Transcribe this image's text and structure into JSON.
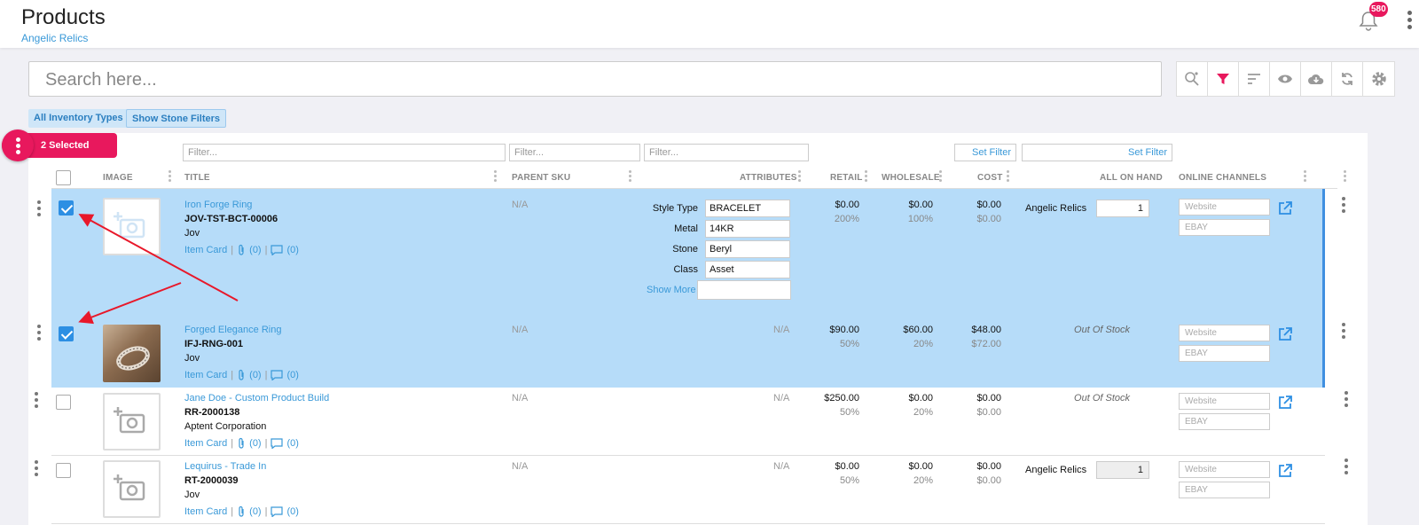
{
  "header": {
    "title": "Products",
    "subtitle": "Angelic Relics",
    "notification_count": "580"
  },
  "search": {
    "placeholder": "Search here..."
  },
  "toolbar": {
    "icons": [
      "search-settings-icon",
      "filter-icon",
      "sort-icon",
      "eye-icon",
      "cloud-download-icon",
      "refresh-icon",
      "gear-icon"
    ],
    "accent": "#e8185d"
  },
  "chips": {
    "inventory_types": "All Inventory Types",
    "stone_filters": "Show Stone Filters"
  },
  "selection": {
    "label": "2 Selected"
  },
  "filters": {
    "title_placeholder": "Filter...",
    "sku_placeholder": "Filter...",
    "attr_placeholder": "Filter...",
    "set_filter_1": "Set Filter",
    "set_filter_2": "Set Filter"
  },
  "columns": {
    "image": "IMAGE",
    "title": "TITLE",
    "parent_sku": "PARENT SKU",
    "attributes": "ATTRIBUTES",
    "retail": "RETAIL",
    "wholesale": "WHOLESALE",
    "cost": "COST",
    "on_hand": "ALL ON HAND",
    "channels": "ONLINE CHANNELS"
  },
  "rows": [
    {
      "selected": true,
      "name": "Iron Forge Ring",
      "sku": "JOV-TST-BCT-00006",
      "brand": "Jov",
      "item_card": "Item Card",
      "attach_count": "(0)",
      "comment_count": "(0)",
      "parent_sku": "N/A",
      "attributes": [
        {
          "label": "Style Type",
          "value": "BRACELET"
        },
        {
          "label": "Metal",
          "value": "14KR"
        },
        {
          "label": "Stone",
          "value": "Beryl"
        },
        {
          "label": "Class",
          "value": "Asset"
        }
      ],
      "show_more": "Show More",
      "retail": "$0.00",
      "retail_pct": "200%",
      "wholesale": "$0.00",
      "wholesale_pct": "100%",
      "cost": "$0.00",
      "cost_sub": "$0.00",
      "location": "Angelic Relics",
      "qty": "1",
      "channels": [
        "Website",
        "EBAY"
      ]
    },
    {
      "selected": true,
      "name": "Forged Elegance Ring",
      "sku": "IFJ-RNG-001",
      "brand": "Jov",
      "item_card": "Item Card",
      "attach_count": "(0)",
      "comment_count": "(0)",
      "parent_sku": "N/A",
      "attributes_na": "N/A",
      "retail": "$90.00",
      "retail_pct": "50%",
      "wholesale": "$60.00",
      "wholesale_pct": "20%",
      "cost": "$48.00",
      "cost_sub": "$72.00",
      "stock": "Out Of Stock",
      "channels": [
        "Website",
        "EBAY"
      ]
    },
    {
      "selected": false,
      "name": "Jane Doe - Custom Product Build",
      "sku": "RR-2000138",
      "brand": "Aptent Corporation",
      "item_card": "Item Card",
      "attach_count": "(0)",
      "comment_count": "(0)",
      "parent_sku": "N/A",
      "attributes_na": "N/A",
      "retail": "$250.00",
      "retail_pct": "50%",
      "wholesale": "$0.00",
      "wholesale_pct": "20%",
      "cost": "$0.00",
      "cost_sub": "$0.00",
      "stock": "Out Of Stock",
      "channels": [
        "Website",
        "EBAY"
      ]
    },
    {
      "selected": false,
      "name": "Lequirus - Trade In",
      "sku": "RT-2000039",
      "brand": "Jov",
      "item_card": "Item Card",
      "attach_count": "(0)",
      "comment_count": "(0)",
      "parent_sku": "N/A",
      "attributes_na": "N/A",
      "retail": "$0.00",
      "retail_pct": "50%",
      "wholesale": "$0.00",
      "wholesale_pct": "20%",
      "cost": "$0.00",
      "cost_sub": "$0.00",
      "location": "Angelic Relics",
      "qty": "1",
      "channels": [
        "Website",
        "EBAY"
      ]
    }
  ],
  "colors": {
    "link": "#3a99d8",
    "selected_row": "#b6dcf9",
    "annotation_arrow": "#e8182a"
  }
}
